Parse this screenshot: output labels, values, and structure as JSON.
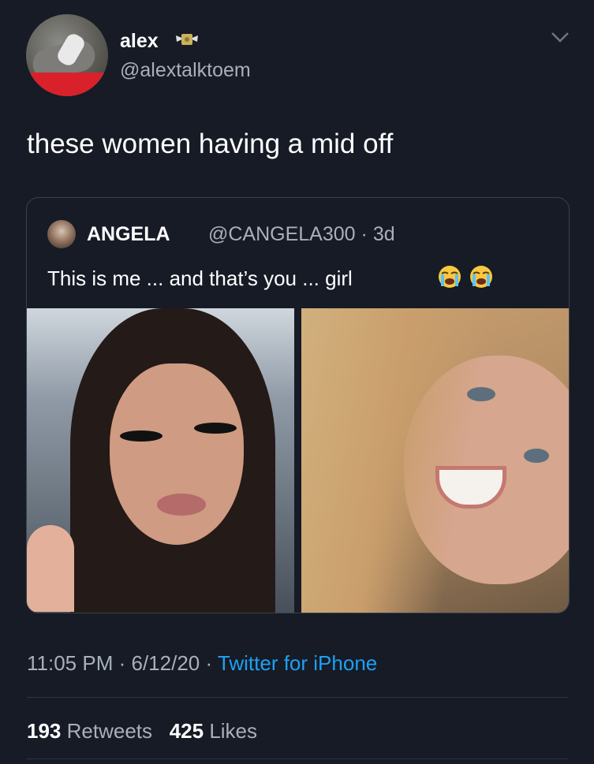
{
  "user": {
    "name": "alex",
    "handle": "@alextalktoem",
    "name_emoji_icon": "money-wings-icon"
  },
  "tweet": {
    "text": "these women having a mid off"
  },
  "quote": {
    "name": "ANGELA",
    "handle": "@CANGELA300",
    "sep": "·",
    "time": "3d",
    "text": "This is me ... and that’s you ... girl",
    "emoji_icons": [
      "loudly-crying-face-icon",
      "loudly-crying-face-icon"
    ]
  },
  "meta": {
    "time": "11:05 PM",
    "sep1": "·",
    "date": "6/12/20",
    "sep2": "·",
    "app": "Twitter for iPhone"
  },
  "stats": {
    "retweets_count": "193",
    "retweets_label": "Retweets",
    "likes_count": "425",
    "likes_label": "Likes"
  },
  "colors": {
    "background": "#161b26",
    "link": "#1da1f2",
    "secondary": "#a9b0b8"
  }
}
